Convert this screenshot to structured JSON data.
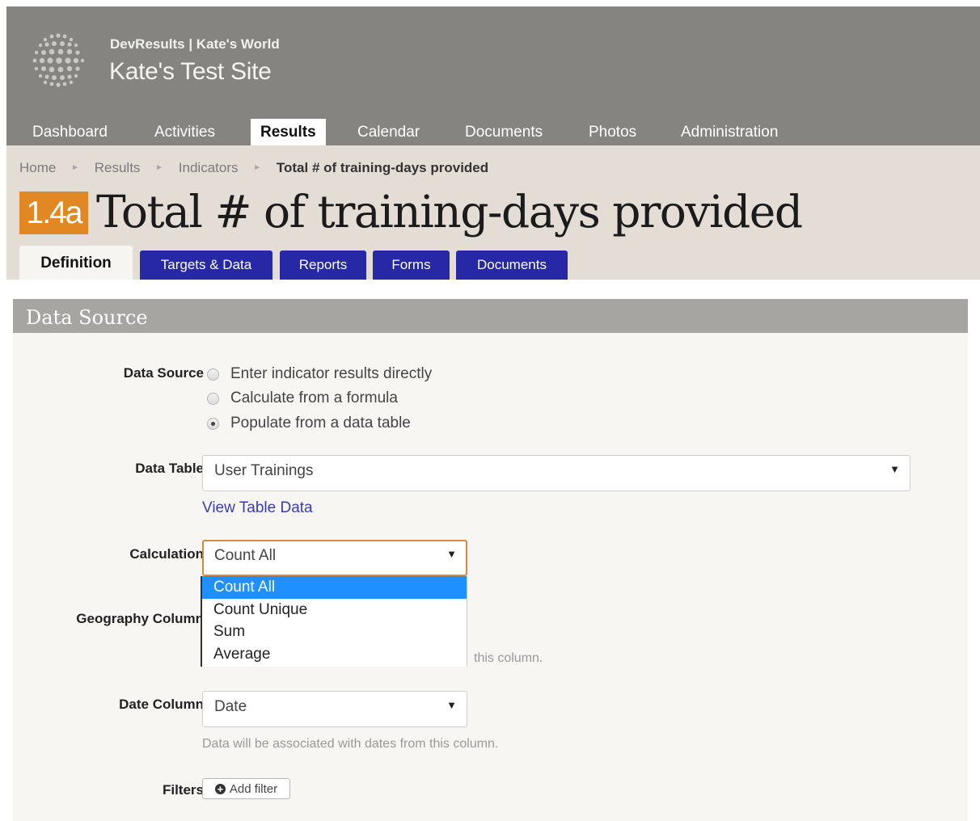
{
  "header": {
    "org_line": "DevResults | Kate's World",
    "site_title": "Kate's Test Site",
    "nav": [
      "Dashboard",
      "Activities",
      "Results",
      "Calendar",
      "Documents",
      "Photos",
      "Administration"
    ],
    "active_nav": "Results"
  },
  "breadcrumb": {
    "items": [
      "Home",
      "Results",
      "Indicators"
    ],
    "current": "Total # of training-days provided"
  },
  "indicator": {
    "code": "1.4a",
    "title": "Total # of training-days provided",
    "code_color": "#e18724"
  },
  "tabs": {
    "definition": "Definition",
    "targets_data": "Targets & Data",
    "reports": "Reports",
    "forms": "Forms",
    "documents": "Documents"
  },
  "section": {
    "title": "Data Source",
    "data_source": {
      "label": "Data Source",
      "options": [
        "Enter indicator results directly",
        "Calculate from a formula",
        "Populate from a data table"
      ],
      "selected": "Populate from a data table"
    },
    "data_table": {
      "label": "Data Table",
      "value": "User Trainings",
      "view_link": "View Table Data"
    },
    "calculation": {
      "label": "Calculation",
      "value": "Count All",
      "options": [
        "Count All",
        "Count Unique",
        "Sum",
        "Average"
      ]
    },
    "geography": {
      "label": "Geography Column",
      "help_fragment": "this column."
    },
    "date_column": {
      "label": "Date Column",
      "value": "Date",
      "help": "Data will be associated with dates from this column."
    },
    "filters": {
      "label": "Filters",
      "add_button": "Add filter"
    }
  },
  "colors": {
    "header_bg": "#858481",
    "subheader_bg": "#e3ddd5",
    "tab_blue": "#2628a6",
    "accent": "#d78b3b",
    "dropdown_selected": "#1e90ff"
  }
}
